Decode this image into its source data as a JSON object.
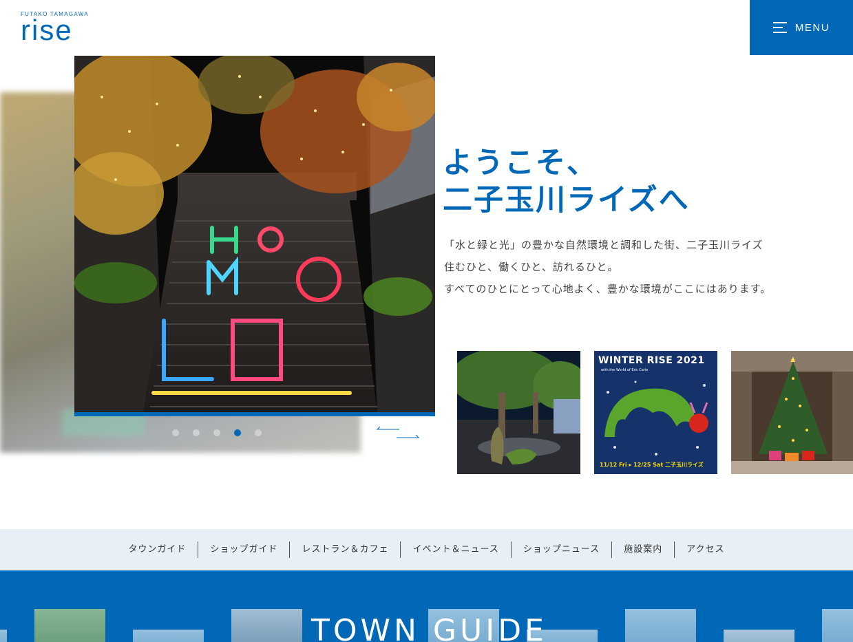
{
  "header": {
    "logo_sub": "FUTAKO TAMAGAWA",
    "logo_main": "rise",
    "menu_label": "MENU"
  },
  "colors": {
    "brand": "#0068b7",
    "nav_bg": "#e8f0f7"
  },
  "hero": {
    "slide_count": 5,
    "active_slide": 4
  },
  "welcome": {
    "title_line1": "ようこそ、",
    "title_line2": "二子玉川ライズへ",
    "body_line1": "「水と緑と光」の豊かな自然環境と調和した街、二子玉川ライズ",
    "body_line2": "住むひと、働くひと、訪れるひと。",
    "body_line3": "すべてのひとにとって心地よく、豊かな環境がここにはあります。"
  },
  "thumbnails": {
    "second": {
      "title": "WINTER RISE 2021",
      "subtitle": "with the World of Eric Carle",
      "dates": "11/12 Fri ▸ 12/25 Sat  二子玉川ライズ"
    }
  },
  "nav": {
    "items": [
      "タウンガイド",
      "ショップガイド",
      "レストラン＆カフェ",
      "イベント＆ニュース",
      "ショップニュース",
      "施設案内",
      "アクセス"
    ]
  },
  "town_guide": {
    "title": "TOWN GUIDE"
  }
}
